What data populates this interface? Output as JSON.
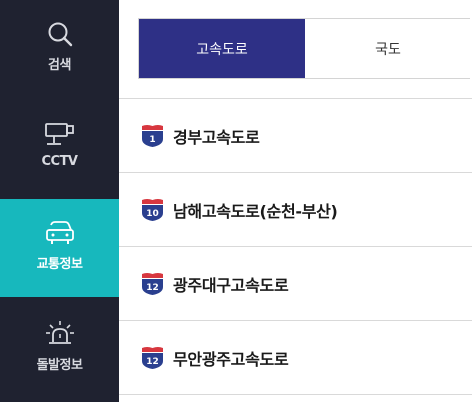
{
  "sidebar": {
    "items": [
      {
        "label": "검색",
        "icon": "search-icon"
      },
      {
        "label": "CCTV",
        "icon": "cctv-icon"
      },
      {
        "label": "교통정보",
        "icon": "car-icon",
        "active": true
      },
      {
        "label": "돌발정보",
        "icon": "alert-light-icon"
      }
    ]
  },
  "tabs": [
    {
      "label": "고속도로",
      "active": true
    },
    {
      "label": "국도",
      "active": false
    }
  ],
  "roads": [
    {
      "number": "1",
      "name": "경부고속도로"
    },
    {
      "number": "10",
      "name": "남해고속도로(순천-부산)"
    },
    {
      "number": "12",
      "name": "광주대구고속도로"
    },
    {
      "number": "12",
      "name": "무안광주고속도로"
    }
  ],
  "colors": {
    "sidebar_bg": "#1f2230",
    "active_teal": "#17b8bd",
    "active_tab": "#2e3086",
    "shield_blue": "#2a3f8f",
    "shield_red": "#d7373f"
  }
}
